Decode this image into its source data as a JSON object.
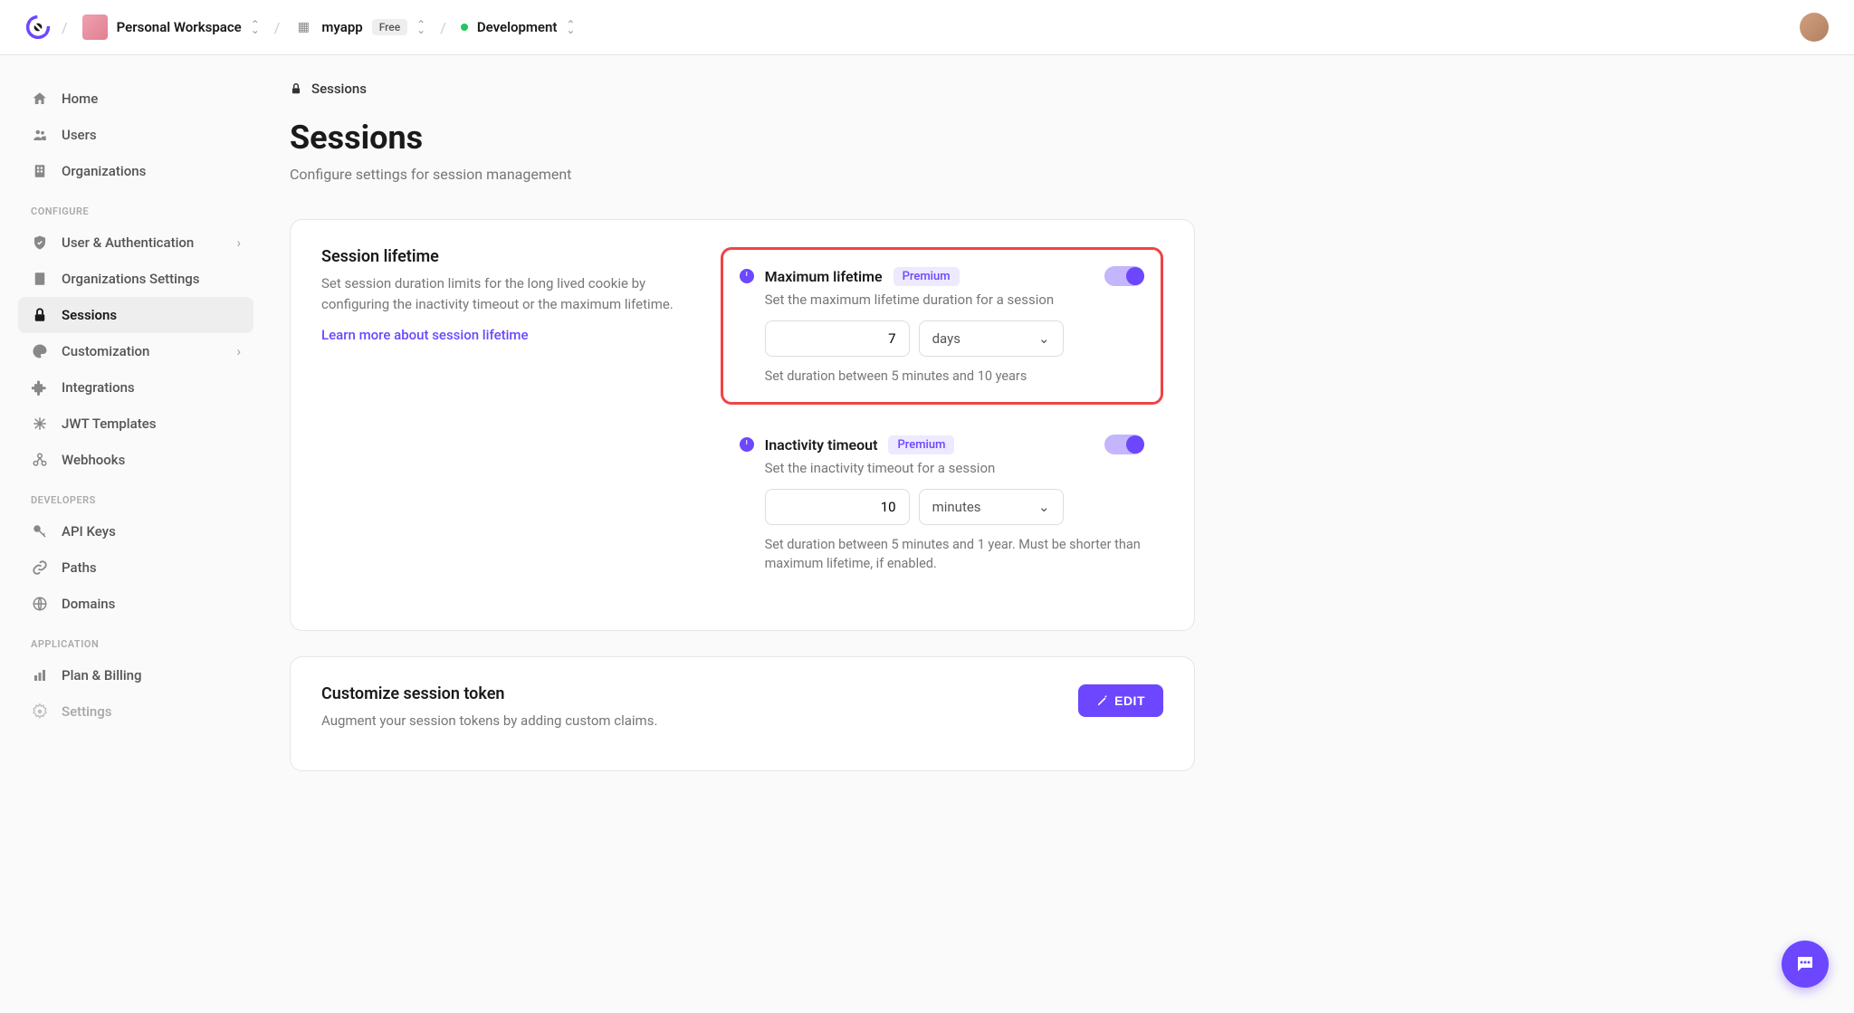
{
  "header": {
    "workspace": "Personal Workspace",
    "app": "myapp",
    "app_badge": "Free",
    "env": "Development"
  },
  "sidebar": {
    "main": [
      {
        "label": "Home"
      },
      {
        "label": "Users"
      },
      {
        "label": "Organizations"
      }
    ],
    "configure_heading": "CONFIGURE",
    "configure": [
      {
        "label": "User & Authentication"
      },
      {
        "label": "Organizations Settings"
      },
      {
        "label": "Sessions"
      },
      {
        "label": "Customization"
      },
      {
        "label": "Integrations"
      },
      {
        "label": "JWT Templates"
      },
      {
        "label": "Webhooks"
      }
    ],
    "developers_heading": "DEVELOPERS",
    "developers": [
      {
        "label": "API Keys"
      },
      {
        "label": "Paths"
      },
      {
        "label": "Domains"
      }
    ],
    "application_heading": "APPLICATION",
    "application": [
      {
        "label": "Plan & Billing"
      },
      {
        "label": "Settings"
      }
    ]
  },
  "page": {
    "crumb": "Sessions",
    "title": "Sessions",
    "subtitle": "Configure settings for session management"
  },
  "lifetime_card": {
    "title": "Session lifetime",
    "desc": "Set session duration limits for the long lived cookie by configuring the inactivity timeout or the maximum lifetime.",
    "link": "Learn more about session lifetime"
  },
  "max_lifetime": {
    "title": "Maximum lifetime",
    "badge": "Premium",
    "desc": "Set the maximum lifetime duration for a session",
    "value": "7",
    "unit": "days",
    "helper": "Set duration between 5 minutes and 10 years"
  },
  "inactivity": {
    "title": "Inactivity timeout",
    "badge": "Premium",
    "desc": "Set the inactivity timeout for a session",
    "value": "10",
    "unit": "minutes",
    "helper": "Set duration between 5 minutes and 1 year. Must be shorter than maximum lifetime, if enabled."
  },
  "token_card": {
    "title": "Customize session token",
    "desc": "Augment your session tokens by adding custom claims.",
    "button": "EDIT"
  }
}
